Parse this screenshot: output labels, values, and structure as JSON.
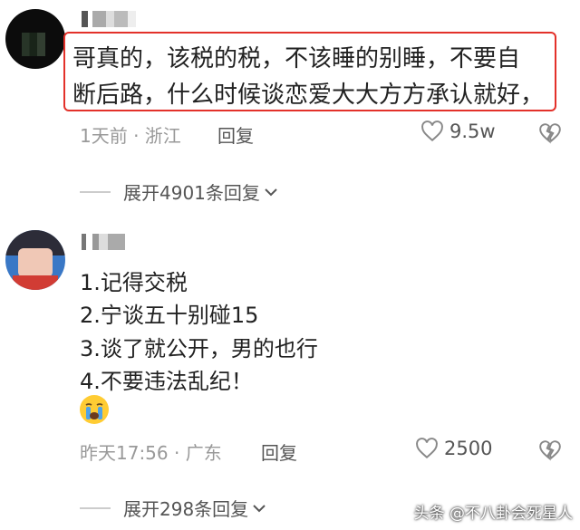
{
  "comments": [
    {
      "text_lines": [
        "哥真的，该税的税，不该睡的别睡，不要自",
        "断后路，什么时候谈恋爱大大方方承认就好，"
      ],
      "meta": "1天前 · 浙江",
      "reply_label": "回复",
      "likes": "9.5w",
      "expand_label": "展开4901条回复"
    },
    {
      "text_lines": [
        "1.记得交税",
        "2.宁谈五十别碰15",
        "3.谈了就公开，男的也行",
        "4.不要违法乱纪！"
      ],
      "meta": "昨天17:56 · 广东",
      "reply_label": "回复",
      "likes": "2500",
      "expand_label": "展开298条回复"
    }
  ],
  "watermark": "头条 @不八卦会死星人",
  "colors": {
    "highlight_border": "#e3312a",
    "meta_text": "#999999"
  },
  "icons": [
    "heart-icon",
    "broken-heart-icon",
    "chevron-down-icon",
    "crying-emoji-icon"
  ]
}
